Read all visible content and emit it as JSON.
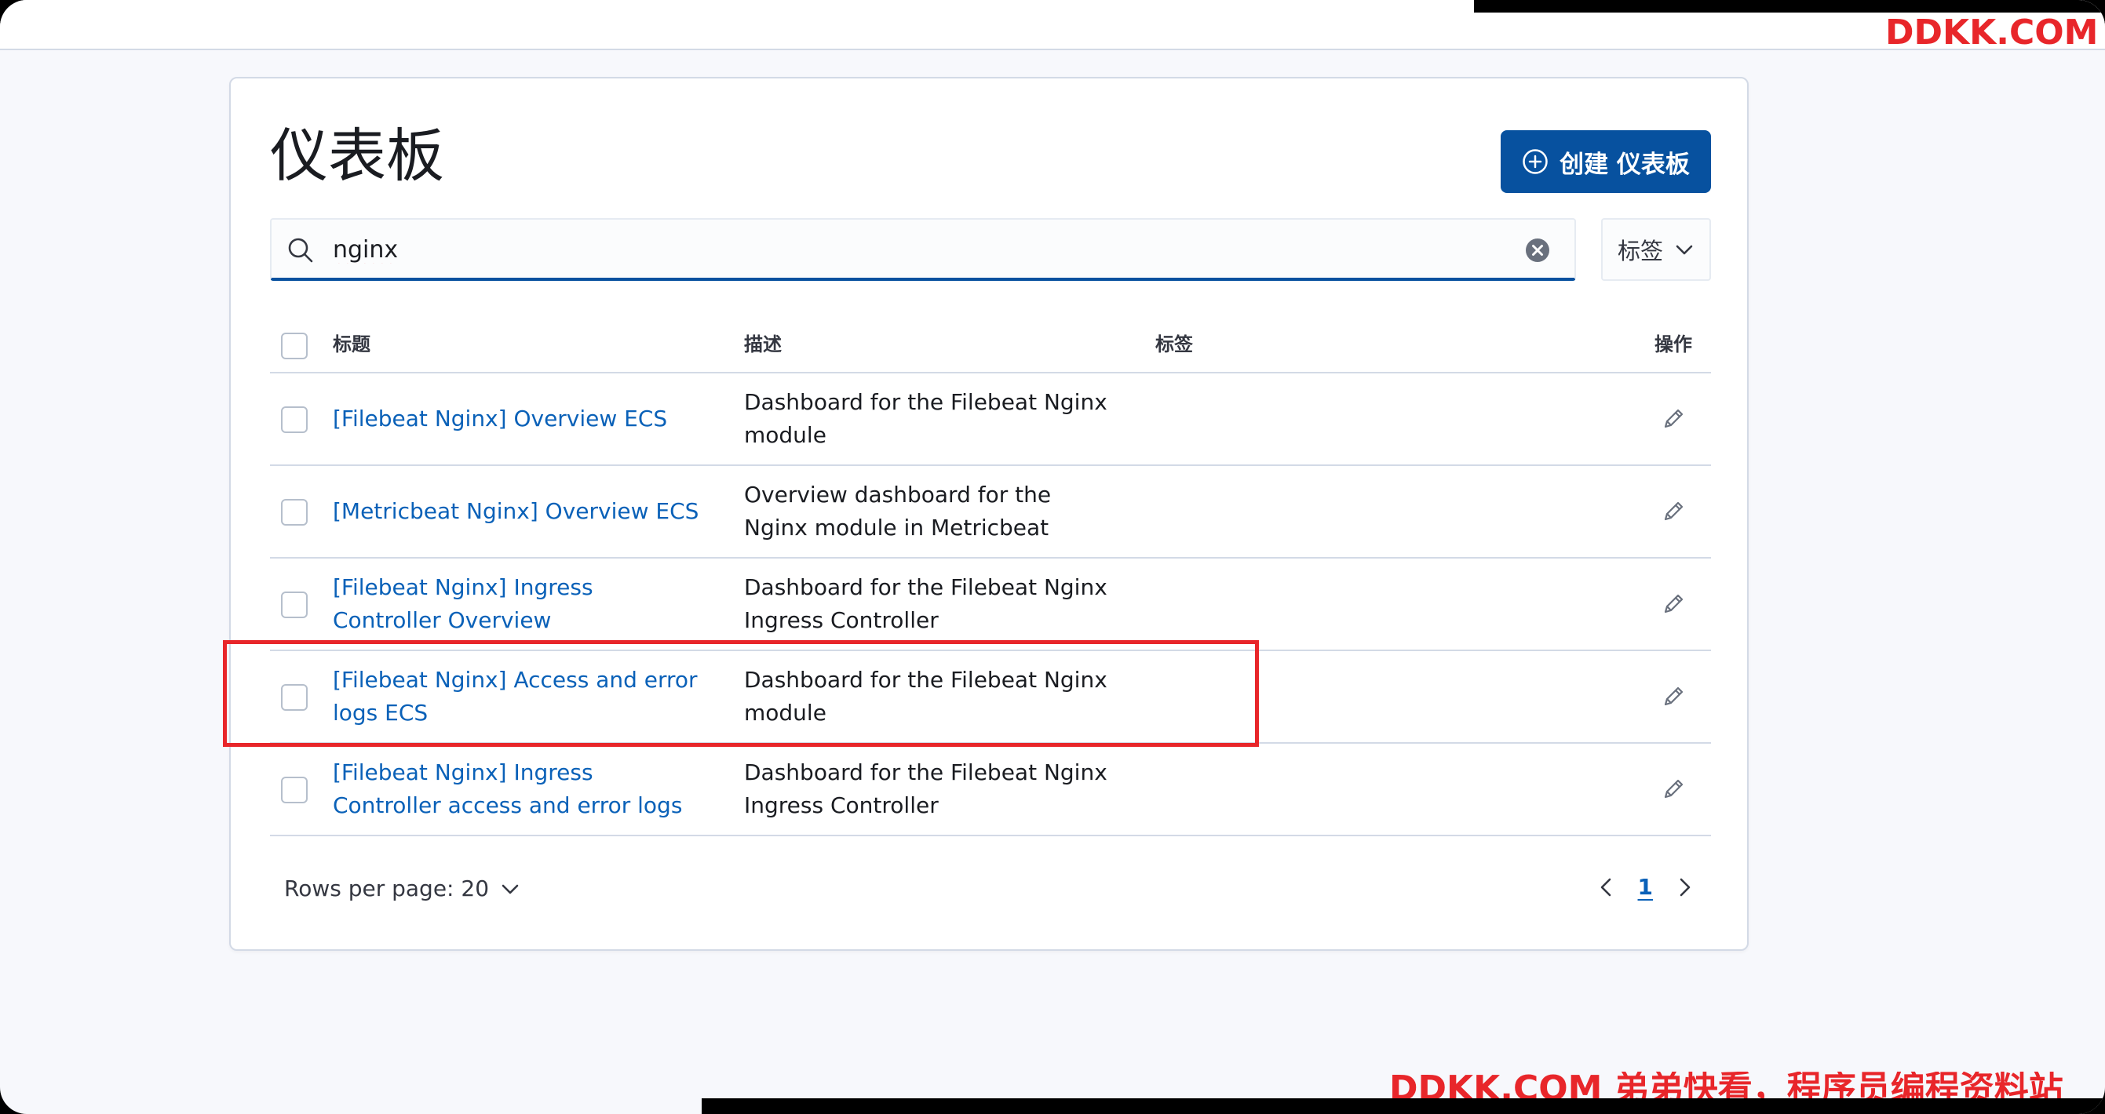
{
  "page": {
    "title": "仪表板",
    "create_button_label": "创建 仪表板"
  },
  "search": {
    "value": "nginx",
    "placeholder": ""
  },
  "filters": {
    "tags_label": "标签"
  },
  "table": {
    "columns": {
      "title": "标题",
      "description": "描述",
      "tags": "标签",
      "actions": "操作"
    },
    "rows": [
      {
        "title": "[Filebeat Nginx] Overview ECS",
        "description": "Dashboard for the Filebeat Nginx module"
      },
      {
        "title": "[Metricbeat Nginx] Overview ECS",
        "description": "Overview dashboard for the Nginx module in Metricbeat"
      },
      {
        "title": "[Filebeat Nginx] Ingress Controller Overview",
        "description": "Dashboard for the Filebeat Nginx Ingress Controller"
      },
      {
        "title": "[Filebeat Nginx] Access and error logs ECS",
        "description": "Dashboard for the Filebeat Nginx module"
      },
      {
        "title": "[Filebeat Nginx] Ingress Controller access and error logs",
        "description": "Dashboard for the Filebeat Nginx Ingress Controller"
      }
    ]
  },
  "pagination": {
    "rows_per_page_label": "Rows per page: 20",
    "current_page": "1"
  },
  "watermark": {
    "top": "DDKK.COM",
    "bottom": "DDKK.COM 弟弟快看，程序员编程资料站"
  },
  "colors": {
    "primary": "#07519f",
    "link": "#0a61b8",
    "highlight": "#e8262a"
  }
}
